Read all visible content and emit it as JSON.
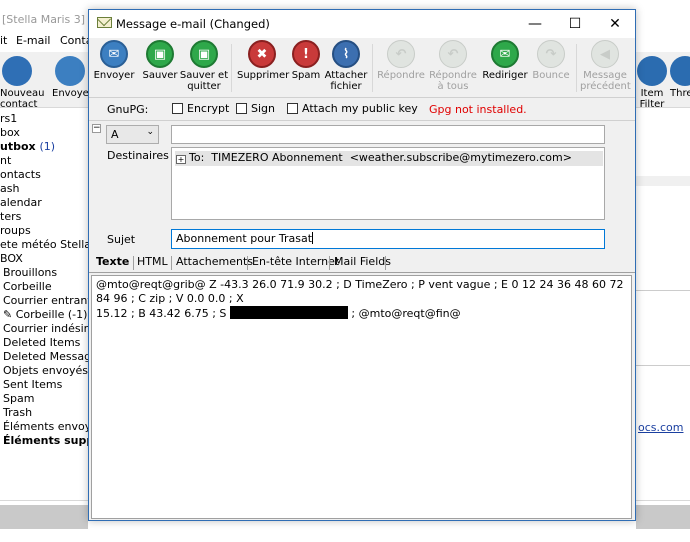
{
  "background": {
    "title": "[Stella Maris 3]",
    "menu": [
      "it",
      "E-mail",
      "Conta"
    ],
    "toolbar": {
      "new_contact": [
        "Nouveau",
        "contact"
      ],
      "send": "Envoyer",
      "item_filter": [
        "Item",
        "Filter"
      ],
      "threads": "Thre"
    },
    "tree": [
      "rs1",
      "box",
      "utbox",
      "(1)",
      "nt",
      "ontacts",
      "ash",
      "alendar",
      "ters",
      "roups",
      "ete météo Stella Ma",
      "BOX",
      "Brouillons",
      "Corbeille",
      "Courrier entrant (-",
      "Corbeille (-1)",
      "Courrier indésirabl",
      "Deleted Items",
      "Deleted Messages",
      "Objets envoyés",
      "Sent Items",
      "Spam",
      "Trash",
      "Éléments envoyés",
      "Éléments supprim"
    ],
    "link": "ocs.com"
  },
  "dialog": {
    "title": "Message e-mail (Changed)",
    "window_buttons": {
      "minimize": "—",
      "maximize": "☐",
      "close": "✕"
    },
    "toolbar": [
      {
        "key": "send",
        "label": [
          "Envoyer",
          ""
        ],
        "icon": "send-icon",
        "color": "#3c7fc1",
        "enabled": true
      },
      {
        "key": "save",
        "label": [
          "Sauver",
          ""
        ],
        "icon": "save-icon",
        "color": "#2ea84a",
        "enabled": true
      },
      {
        "key": "save_quit",
        "label": [
          "Sauver et",
          "quitter"
        ],
        "icon": "save-quit-icon",
        "color": "#2ea84a",
        "enabled": true
      },
      {
        "key": "delete",
        "label": [
          "Supprimer",
          ""
        ],
        "icon": "delete-icon",
        "color": "#c93a3a",
        "enabled": true
      },
      {
        "key": "spam",
        "label": [
          "Spam",
          ""
        ],
        "icon": "spam-icon",
        "color": "#c93a3a",
        "enabled": true
      },
      {
        "key": "attach",
        "label": [
          "Attacher",
          "fichier"
        ],
        "icon": "paperclip-icon",
        "color": "#3c6fb0",
        "enabled": true
      },
      {
        "key": "reply",
        "label": [
          "Répondre",
          ""
        ],
        "icon": "reply-icon",
        "color": "#a7c0a7",
        "enabled": false
      },
      {
        "key": "reply_all",
        "label": [
          "Répondre",
          "à tous"
        ],
        "icon": "reply-all-icon",
        "color": "#a7c0a7",
        "enabled": false
      },
      {
        "key": "forward",
        "label": [
          "Rediriger",
          ""
        ],
        "icon": "forward-icon",
        "color": "#2ea84a",
        "enabled": true
      },
      {
        "key": "bounce",
        "label": [
          "Bounce",
          ""
        ],
        "icon": "bounce-icon",
        "color": "#a7c0a7",
        "enabled": false
      },
      {
        "key": "prev",
        "label": [
          "Message",
          "précédent"
        ],
        "icon": "previous-icon",
        "color": "#b7c4d0",
        "enabled": false
      }
    ],
    "gnupg": {
      "label": "GnuPG:",
      "encrypt": "Encrypt",
      "sign": "Sign",
      "attach_key": "Attach my public key",
      "warning": "Gpg not installed.",
      "warning_color": "#e00000"
    },
    "recipients": {
      "type_selected": "A",
      "new_recipient_value": "",
      "label": "Destinaires",
      "entries": [
        {
          "prefix": "To:",
          "name": "TIMEZERO Abonnement",
          "email": "<weather.subscribe@mytimezero.com>"
        }
      ]
    },
    "subject": {
      "label": "Sujet",
      "value": "Abonnement pour Trasat"
    },
    "tabs": [
      "Texte",
      "HTML",
      "Attachements",
      "En-tête Internet",
      "Mail Fields"
    ],
    "active_tab": "Texte",
    "body": {
      "line1": "@mto@reqt@grib@ Z -43.3 26.0 71.9 30.2 ; D TimeZero ; P vent vague ; E 0 12 24 36 48 60 72 84 96 ; C zip ; V 0.0 0.0 ; X",
      "line2_before": "15.12 ; B 43.42 6.75 ; S",
      "line2_after": "; @mto@reqt@fin@"
    }
  }
}
